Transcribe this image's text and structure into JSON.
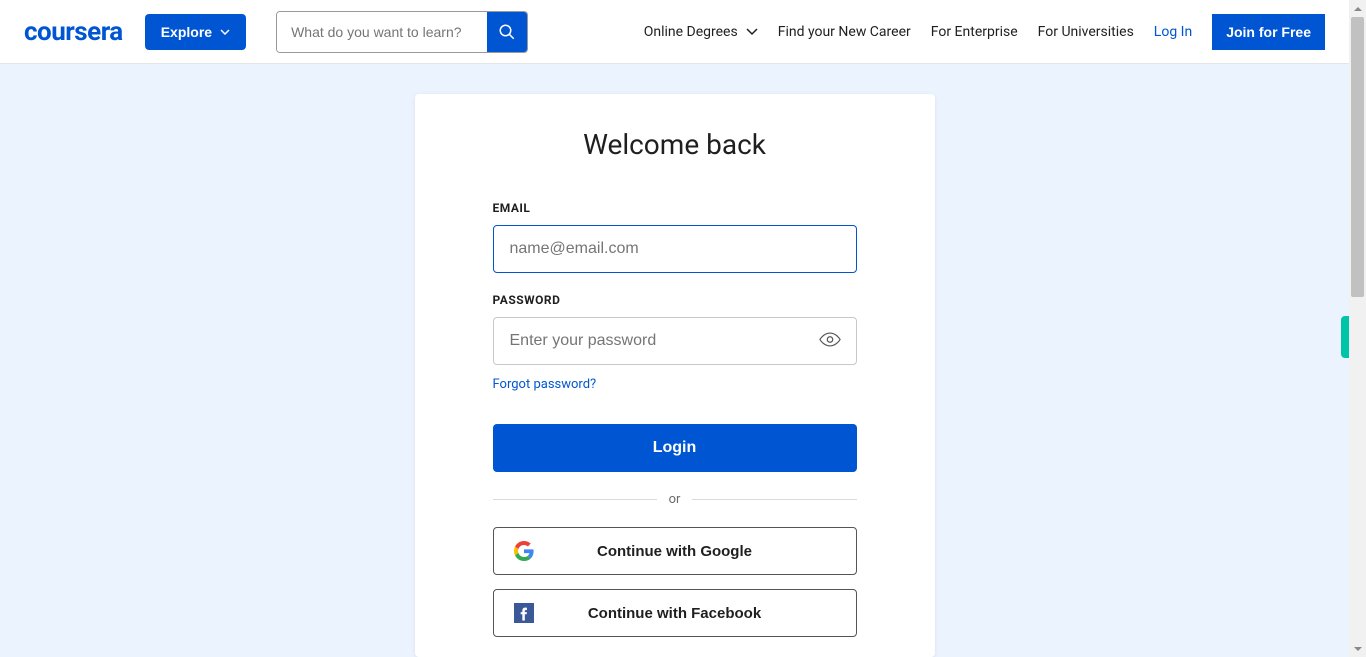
{
  "header": {
    "logo": "coursera",
    "explore": "Explore",
    "search_placeholder": "What do you want to learn?",
    "nav": {
      "online_degrees": "Online Degrees",
      "new_career": "Find your New Career",
      "enterprise": "For Enterprise",
      "universities": "For Universities",
      "login": "Log In",
      "join": "Join for Free"
    }
  },
  "login": {
    "title": "Welcome back",
    "email_label": "EMAIL",
    "email_placeholder": "name@email.com",
    "password_label": "PASSWORD",
    "password_placeholder": "Enter your password",
    "forgot": "Forgot password?",
    "submit": "Login",
    "or": "or",
    "google": "Continue with Google",
    "facebook": "Continue with Facebook"
  }
}
